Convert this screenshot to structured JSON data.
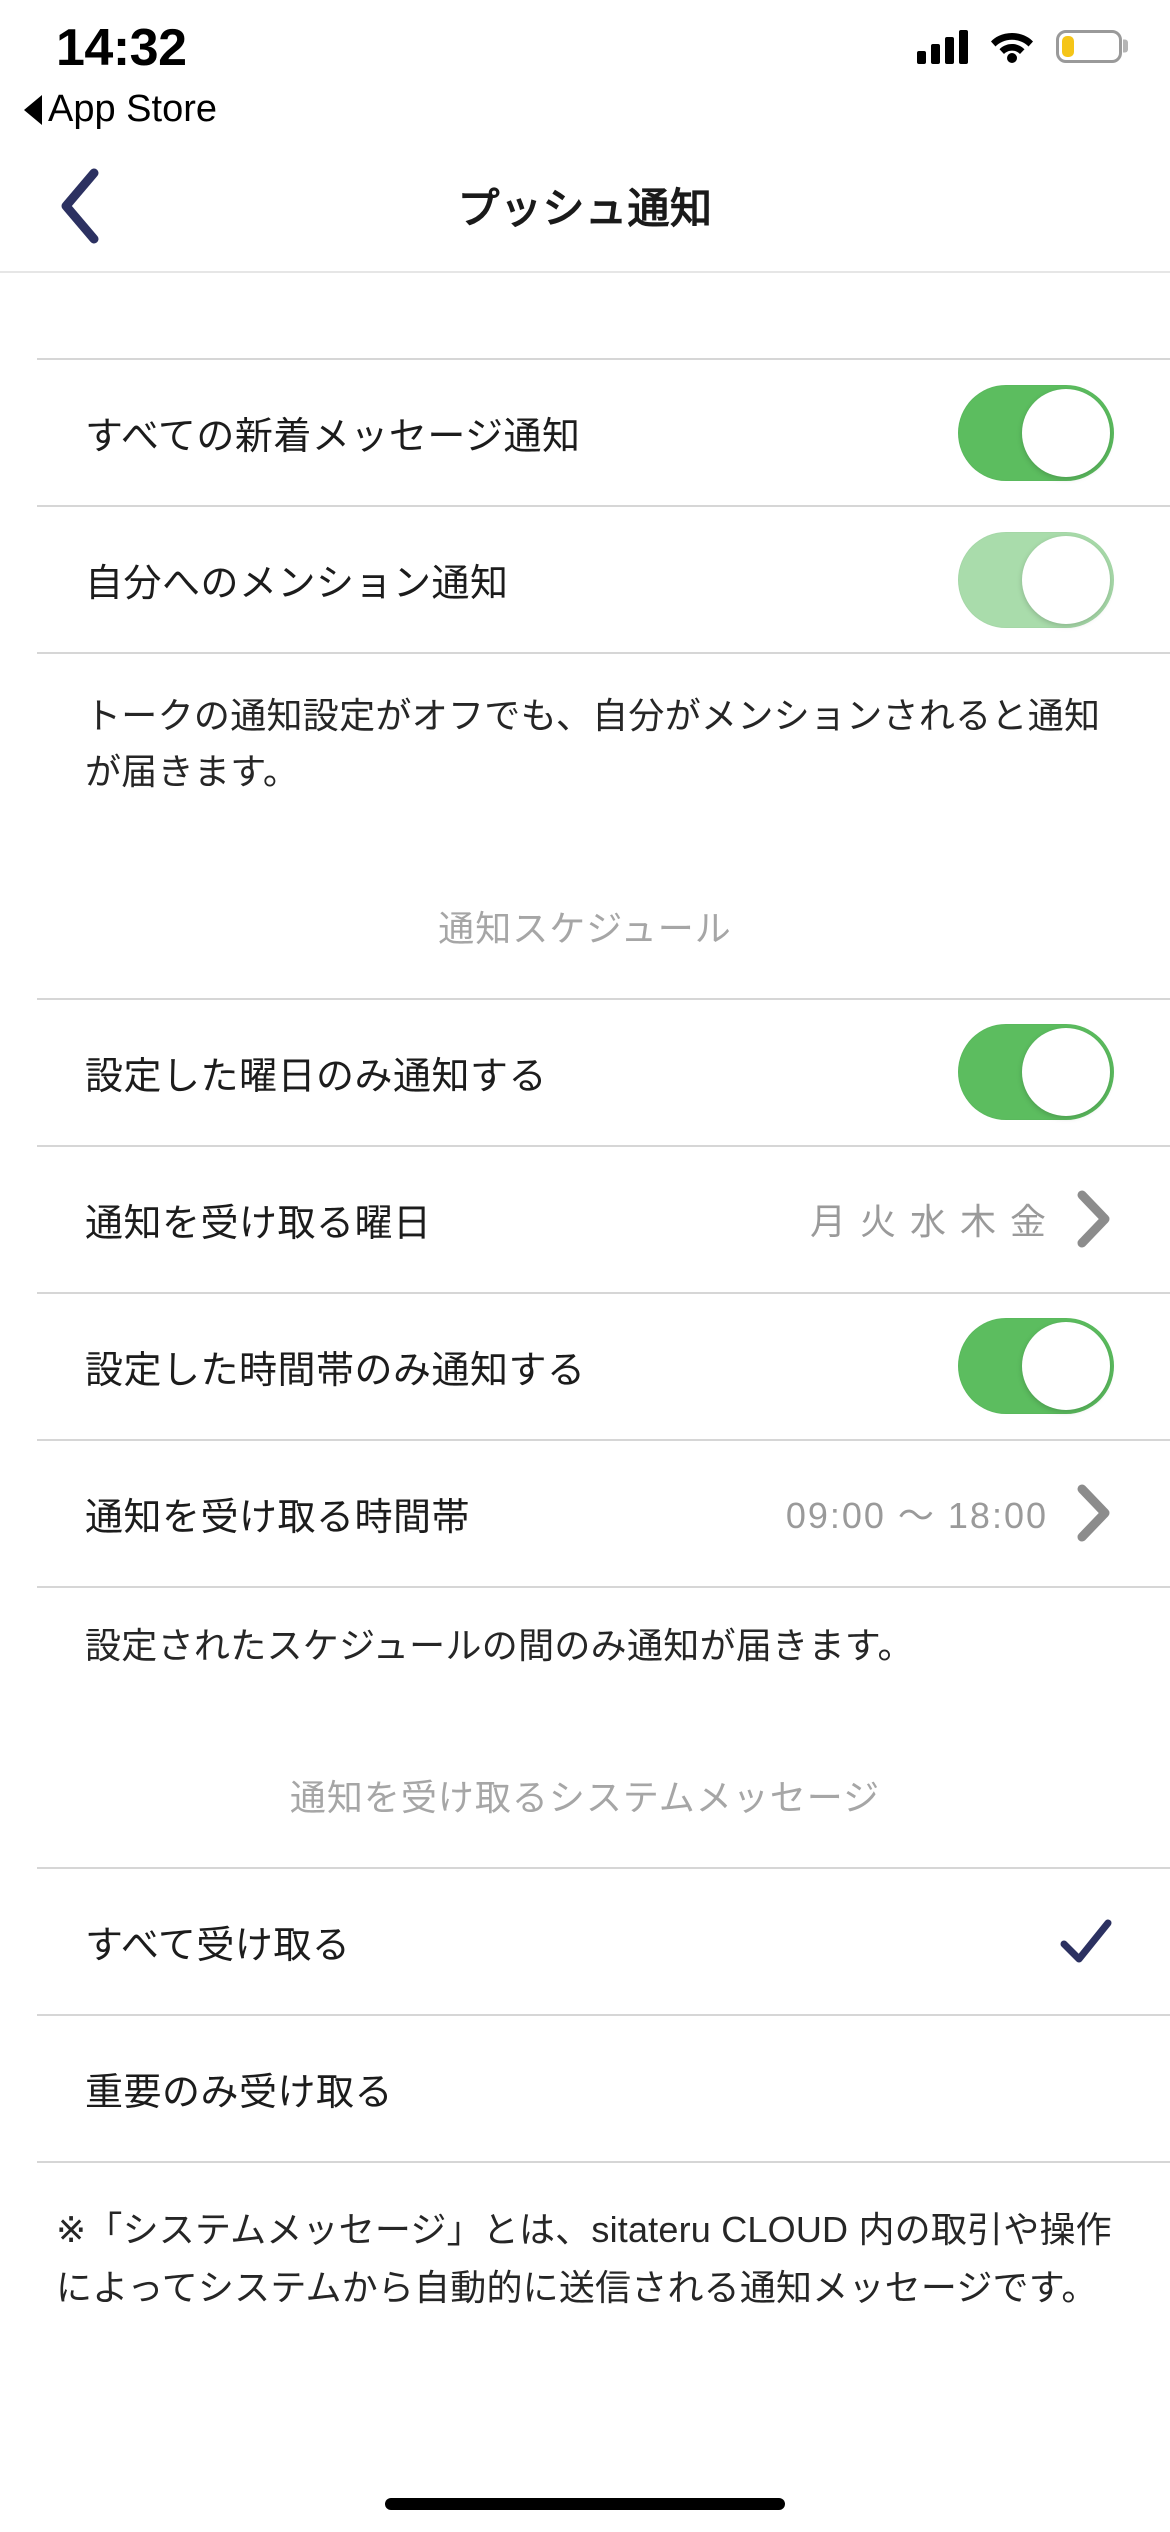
{
  "status_bar": {
    "time": "14:32",
    "back_app_label": "App Store",
    "signal_icon": "cellular-bars-icon",
    "wifi_icon": "wifi-icon",
    "battery_icon": "battery-low-icon",
    "battery_color": "#f5c518"
  },
  "nav": {
    "back_icon": "chevron-left-icon",
    "back_color": "#2c3161",
    "title": "プッシュ通知"
  },
  "sections": {
    "general": {
      "rows": [
        {
          "label": "すべての新着メッセージ通知",
          "toggle": "on",
          "toggle_color": "#5cbd5f"
        },
        {
          "label": "自分へのメンション通知",
          "toggle": "on-disabled",
          "toggle_color": "#a9dcab"
        }
      ],
      "note": "トークの通知設定がオフでも、自分がメンションされると通知が届きます。"
    },
    "schedule": {
      "header": "通知スケジュール",
      "rows": [
        {
          "label": "設定した曜日のみ通知する",
          "toggle": "on",
          "toggle_color": "#5cbd5f"
        },
        {
          "label": "通知を受け取る曜日",
          "value": "月 火 水 木 金",
          "accessory": "chevron-right-icon"
        },
        {
          "label": "設定した時間帯のみ通知する",
          "toggle": "on",
          "toggle_color": "#5cbd5f"
        },
        {
          "label": "通知を受け取る時間帯",
          "value": "09:00 〜 18:00",
          "accessory": "chevron-right-icon"
        }
      ],
      "note": "設定されたスケジュールの間のみ通知が届きます。"
    },
    "system_messages": {
      "header": "通知を受け取るシステムメッセージ",
      "options": [
        {
          "label": "すべて受け取る",
          "selected": true,
          "accessory": "check-icon"
        },
        {
          "label": "重要のみ受け取る",
          "selected": false,
          "accessory": ""
        }
      ],
      "footnote": "※「システムメッセージ」とは、sitateru CLOUD 内の取引や操作によってシステムから自動的に送信される通知メッセージです。"
    }
  },
  "colors": {
    "accent_navy": "#2c3161",
    "toggle_on": "#5cbd5f",
    "toggle_faded": "#a9dcab",
    "separator": "#d6d6d6",
    "muted_text": "#9a9a9a"
  }
}
